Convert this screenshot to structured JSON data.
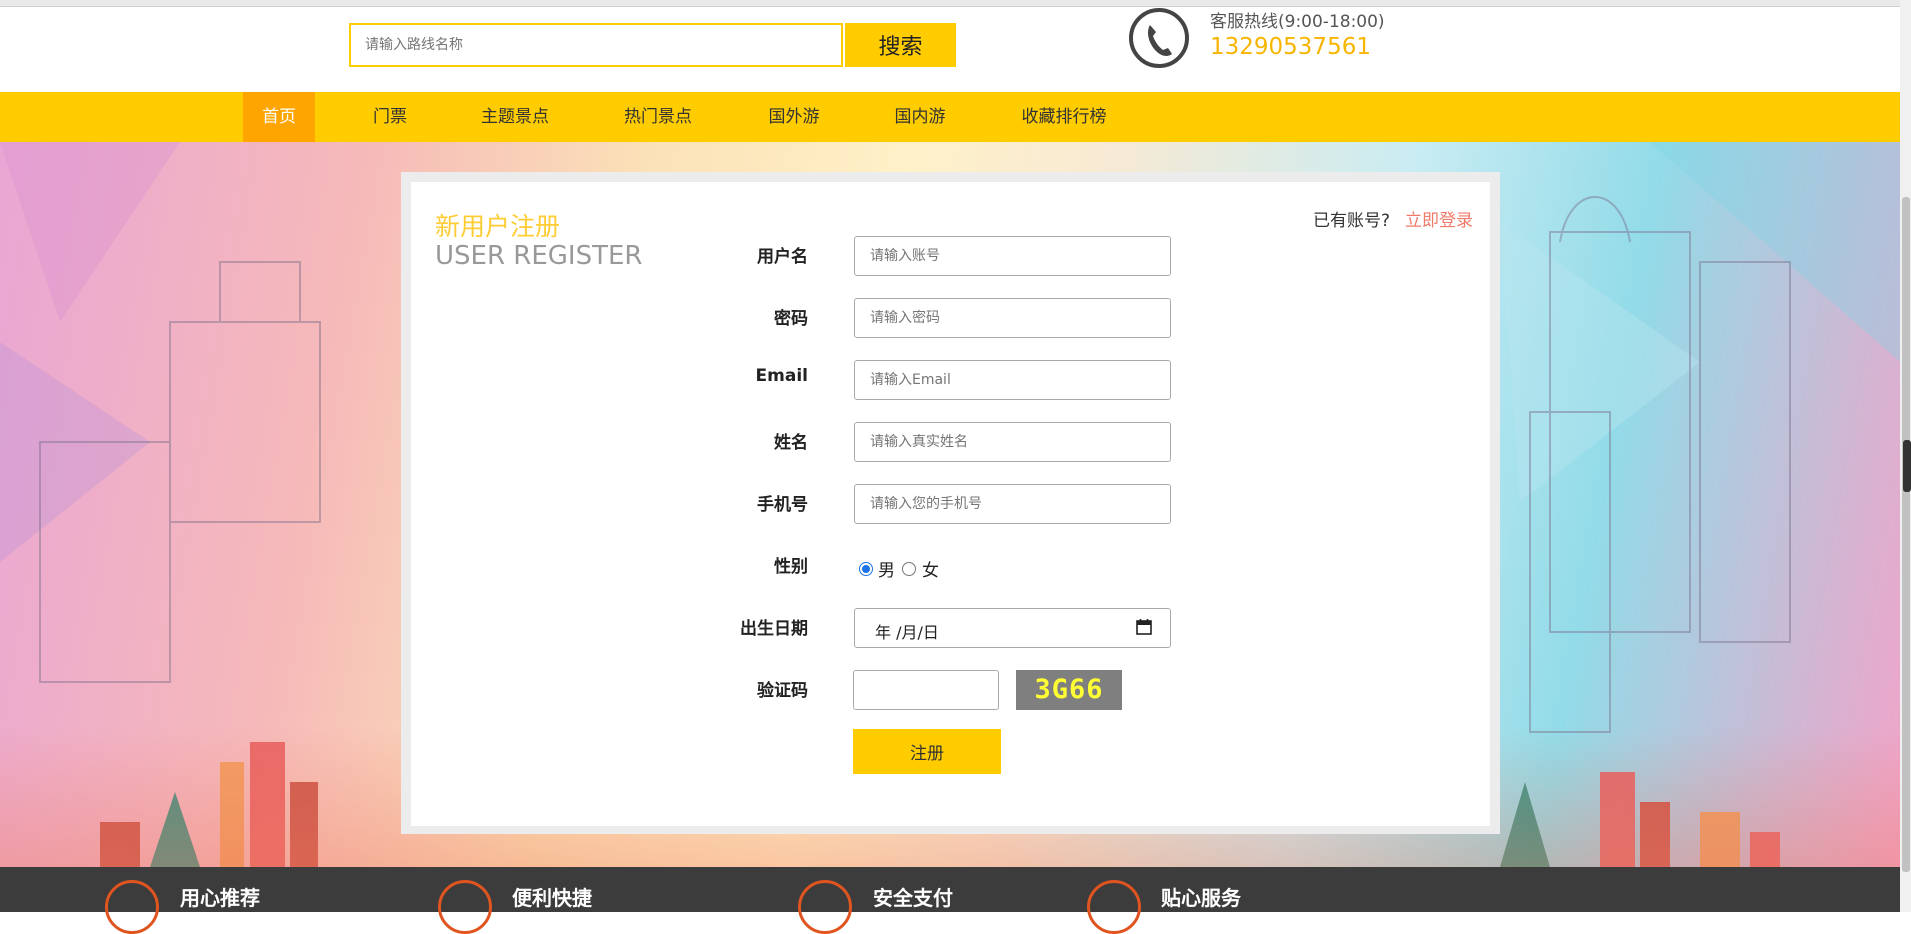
{
  "search": {
    "placeholder": "请输入路线名称",
    "button_label": "搜索"
  },
  "hotline": {
    "label": "客服热线(9:00-18:00)",
    "number": "13290537561"
  },
  "nav": {
    "items": [
      "首页",
      "门票",
      "主题景点",
      "热门景点",
      "国外游",
      "国内游",
      "收藏排行榜"
    ],
    "active_index": 0
  },
  "register": {
    "title_cn": "新用户注册",
    "title_en": "USER REGISTER",
    "have_account": "已有账号?",
    "login_link": "立即登录",
    "fields": {
      "username": {
        "label": "用户名",
        "placeholder": "请输入账号"
      },
      "password": {
        "label": "密码",
        "placeholder": "请输入密码"
      },
      "email": {
        "label": "Email",
        "placeholder": "请输入Email"
      },
      "name": {
        "label": "姓名",
        "placeholder": "请输入真实姓名"
      },
      "phone": {
        "label": "手机号",
        "placeholder": "请输入您的手机号"
      },
      "gender": {
        "label": "性别",
        "male": "男",
        "female": "女",
        "selected": "男"
      },
      "birthday": {
        "label": "出生日期",
        "value_text": "年 /月/日"
      },
      "captcha": {
        "label": "验证码",
        "code": "3G66"
      }
    },
    "submit_label": "注册"
  },
  "footer": {
    "features": [
      "用心推荐",
      "便利快捷",
      "安全支付",
      "贴心服务"
    ]
  },
  "colors": {
    "brand_yellow": "#ffcc00",
    "nav_active": "#ffa500",
    "login_link": "#f07a6a",
    "footer_bg": "#3c3c3c",
    "accent_orange": "#e0541f"
  }
}
